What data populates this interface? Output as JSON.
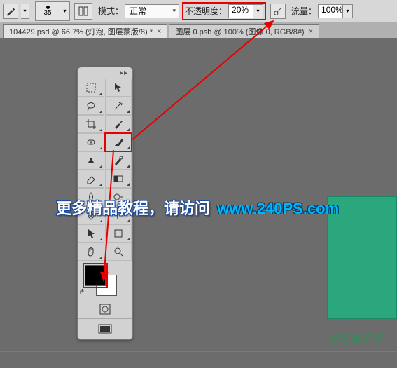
{
  "options_bar": {
    "brush_size": "35",
    "mode_label": "模式：",
    "mode_value": "正常",
    "opacity_label": "不透明度：",
    "opacity_value": "20%",
    "flow_label": "流量：",
    "flow_value": "100%"
  },
  "tabs": [
    {
      "label": "104429.psd @ 66.7% (灯泡, 图层蒙版/8) *",
      "active": true
    },
    {
      "label": "图层 0.psb @ 100% (图像 0, RGB/8#)",
      "active": false
    }
  ],
  "tools": {
    "rows": [
      [
        "move-tool-icon",
        "marquee-tool-icon"
      ],
      [
        "lasso-tool-icon",
        "magic-wand-tool-icon"
      ],
      [
        "crop-tool-icon",
        "eyedropper-tool-icon"
      ],
      [
        "healing-brush-tool-icon",
        "brush-tool-icon"
      ],
      [
        "clone-stamp-tool-icon",
        "history-brush-tool-icon"
      ],
      [
        "eraser-tool-icon",
        "gradient-tool-icon"
      ],
      [
        "blur-tool-icon",
        "dodge-tool-icon"
      ],
      [
        "pen-tool-icon",
        "type-tool-icon"
      ],
      [
        "path-select-tool-icon",
        "shape-tool-icon"
      ],
      [
        "hand-tool-icon",
        "zoom-tool-icon"
      ]
    ],
    "highlighted_tool": "brush-tool-icon",
    "fg_color": "#000000",
    "bg_color": "#ffffff",
    "fg_highlighted": true
  },
  "overlay": {
    "text_main": "更多精品教程，请访问",
    "text_url": "www.240PS.com"
  },
  "watermark": {
    "main": "PS",
    "sub": "爱好者"
  },
  "colors": {
    "accent_red": "#e60000",
    "canvas_bg": "#6c6c6c",
    "shape_green": "#2aa77d"
  }
}
